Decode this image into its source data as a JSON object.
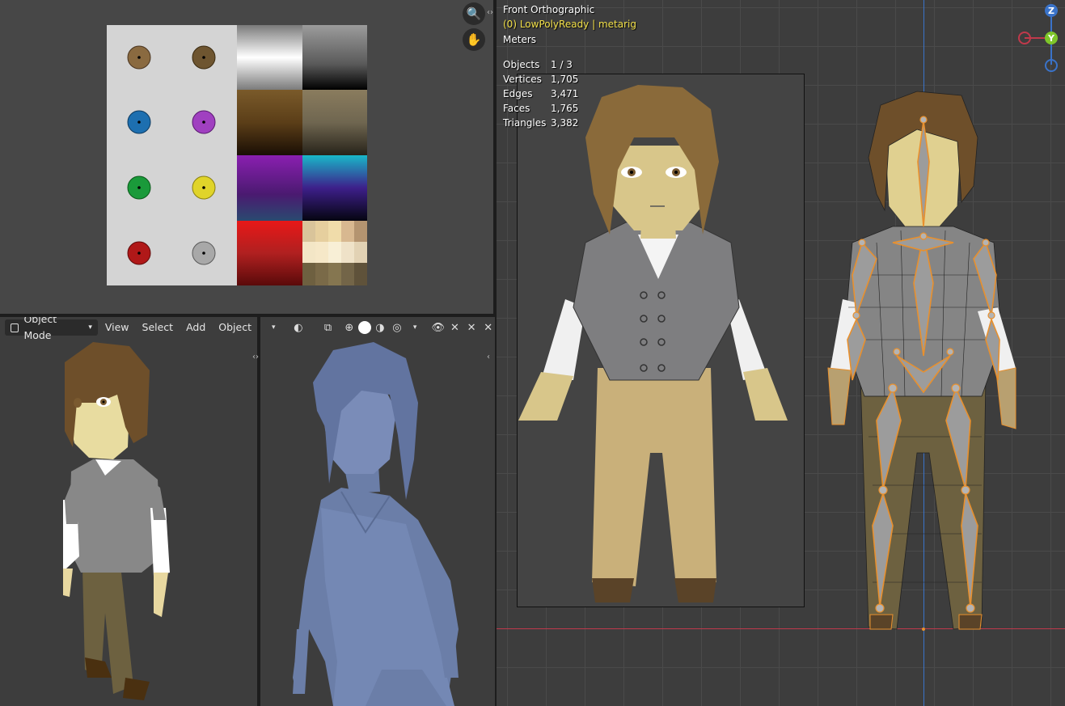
{
  "viewport_right": {
    "view_name": "Front Orthographic",
    "object_info": "(0) LowPolyReady | metarig",
    "units": "Meters",
    "stats": [
      {
        "label": "Objects",
        "value": "1 / 3"
      },
      {
        "label": "Vertices",
        "value": "1,705"
      },
      {
        "label": "Edges",
        "value": "3,471"
      },
      {
        "label": "Faces",
        "value": "1,765"
      },
      {
        "label": "Triangles",
        "value": "3,382"
      }
    ],
    "gizmo": {
      "z": "Z",
      "y": "Y"
    }
  },
  "viewport_left_header": {
    "mode": "Object Mode",
    "menus": [
      "View",
      "Select",
      "Add",
      "Object"
    ]
  },
  "colors": {
    "area_bg": "#474747",
    "viewport_bg": "#3d3d3d",
    "hud_yellow": "#f2e04a",
    "x_axis": "#c0394b",
    "z_axis": "#3a73c9",
    "rig_orange": "#e8902e"
  },
  "icons": [
    "zoom-icon",
    "hand-pan-icon",
    "editor-type-icon",
    "overlay-icon",
    "shading-wire-icon",
    "shading-solid-icon",
    "shading-material-icon",
    "shading-render-icon",
    "visibility-eye-icon",
    "expand-arrows-icon"
  ]
}
